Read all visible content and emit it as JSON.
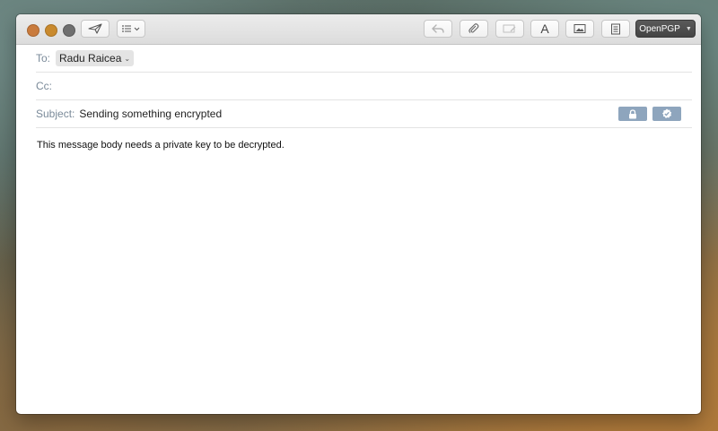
{
  "toolbar": {
    "send_icon": "paper-plane-icon",
    "header_fields_icon": "list-icon",
    "reply_icon": "reply-icon",
    "attach_icon": "paperclip-icon",
    "markup_icon": "markup-icon",
    "format_label": "A",
    "photo_icon": "photo-icon",
    "stationery_icon": "stationery-icon",
    "openpgp_label": "OpenPGP"
  },
  "header": {
    "to_label": "To:",
    "to_recipient": "Radu Raicea",
    "cc_label": "Cc:",
    "subject_label": "Subject:",
    "subject_value": "Sending something encrypted",
    "encrypt_icon": "lock-icon",
    "sign_icon": "checkmark-seal-icon"
  },
  "body": {
    "text": "This message body needs a private key to be decrypted."
  },
  "colors": {
    "security_button": "#8ea5bd",
    "label_gray": "#7a8a99"
  }
}
